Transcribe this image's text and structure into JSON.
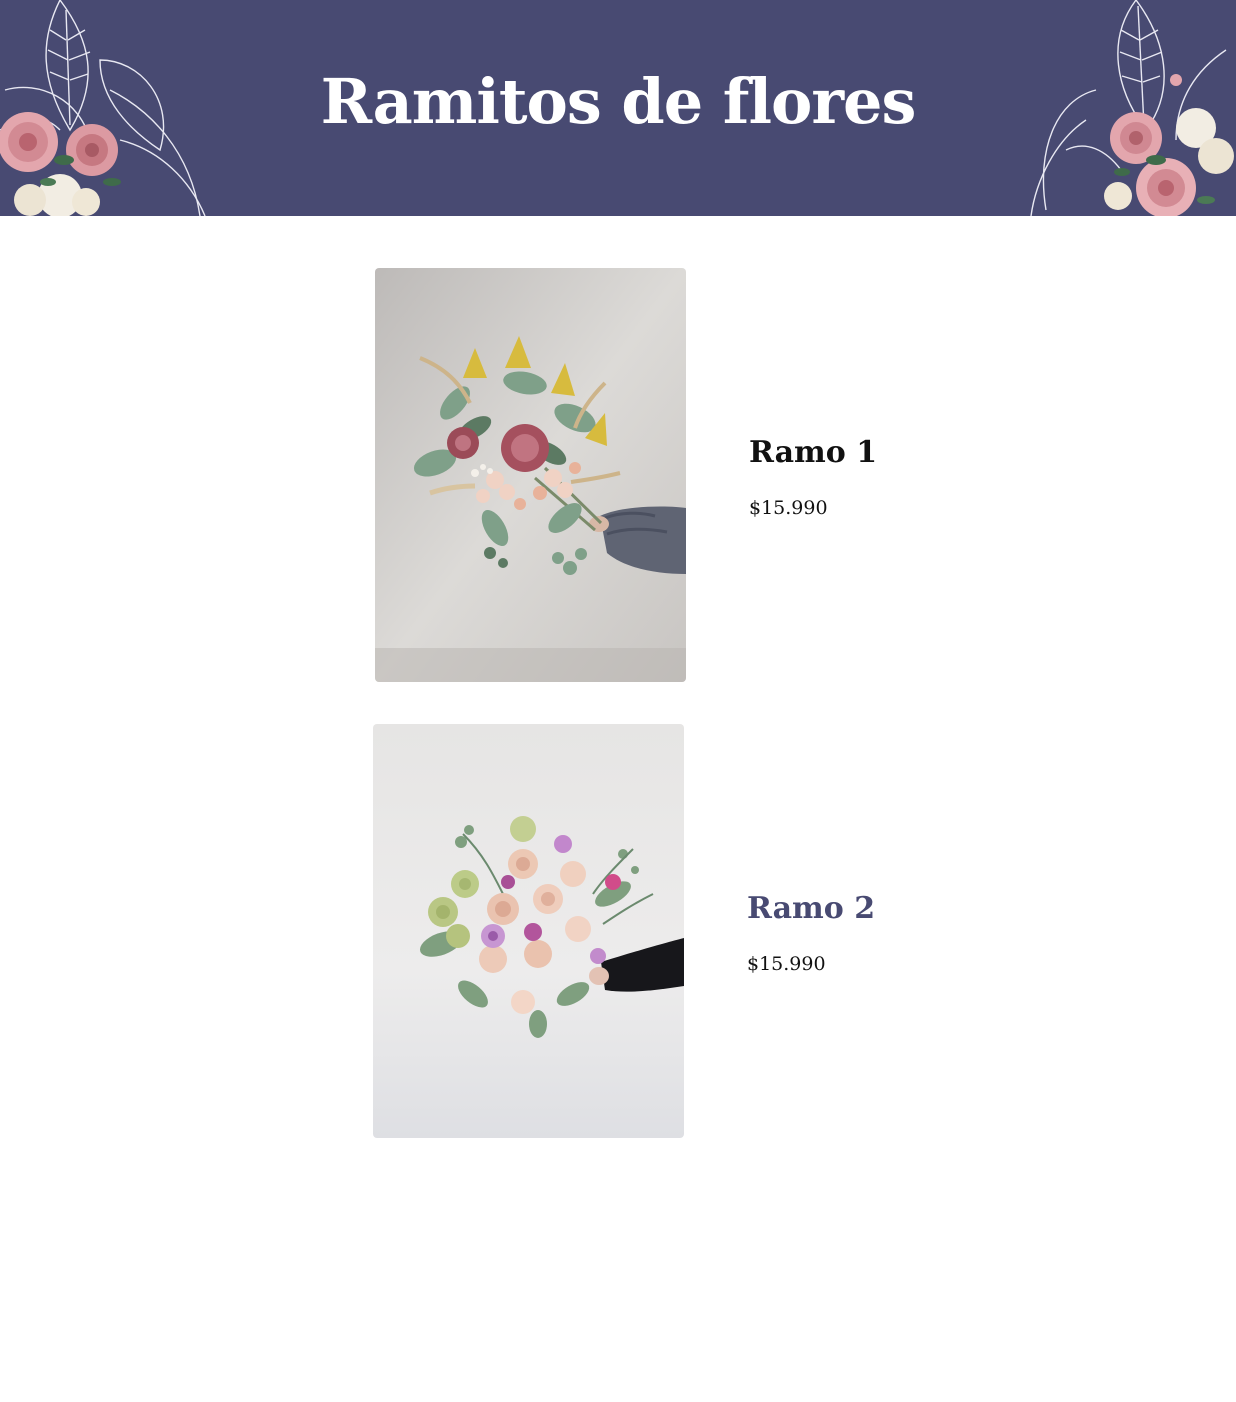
{
  "header": {
    "title": "Ramitos de flores",
    "background_color": "#484a72",
    "decoration": "floral-corner-illustration"
  },
  "products": [
    {
      "name": "Ramo 1",
      "price": "$15.990",
      "image": "bouquet-photo-dried-protea",
      "name_color": "#111111"
    },
    {
      "name": "Ramo 2",
      "price": "$15.990",
      "image": "bouquet-photo-roses",
      "name_color": "#484a72"
    }
  ]
}
